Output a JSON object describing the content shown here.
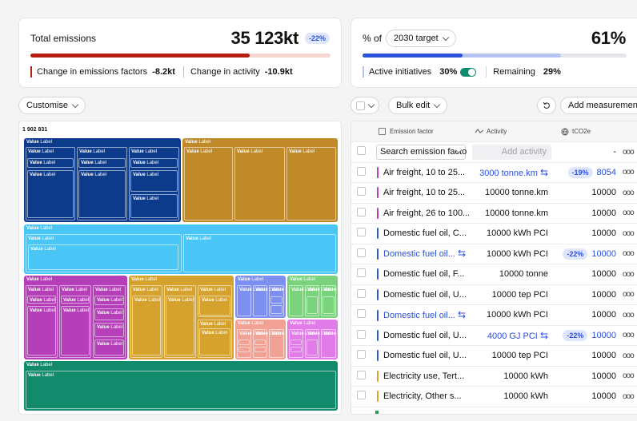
{
  "emissions_card": {
    "title": "Total emissions",
    "value": "35 123kt",
    "badge": "-22%",
    "progress": 0.73,
    "factors_label": "Change in emissions factors",
    "factors_value": "-8.2kt",
    "activity_label": "Change in activity",
    "activity_value": "-10.9kt"
  },
  "target_card": {
    "prefix": "% of",
    "target_select": "2030 target",
    "value": "61%",
    "progress_dark": 0.38,
    "progress_light": 0.75,
    "active_label": "Active initiatives",
    "active_value": "30%",
    "remaining_label": "Remaining",
    "remaining_value": "29%"
  },
  "left_panel": {
    "customise_label": "Customise",
    "treemap_total": "1 902 831",
    "value_word": "Value",
    "label_word": "Label"
  },
  "toolbar": {
    "bulk_edit_label": "Bulk edit",
    "add_measurement_label": "Add measurement"
  },
  "table": {
    "headers": {
      "factor": "Emission factor",
      "activity": "Activity",
      "tco2e": "tCO2e"
    },
    "search_placeholder": "Search emission facto",
    "add_activity_placeholder": "Add activity",
    "empty_value": "-",
    "rows": [
      {
        "factor": "Air freight, 10 to 25...",
        "color": "#b43fb8",
        "activity": "3000 tonne.km",
        "activity_blue": true,
        "swap": true,
        "badge": "-19%",
        "tco2e": "8054",
        "tco2e_blue": true
      },
      {
        "factor": "Air freight, 10 to 25...",
        "color": "#b43fb8",
        "activity": "10000 tonne.km",
        "tco2e": "10000"
      },
      {
        "factor": "Air freight, 26 to 100...",
        "color": "#b43fb8",
        "activity": "10000 tonne.km",
        "tco2e": "10000"
      },
      {
        "factor": "Domestic fuel oil, C...",
        "color": "#3356d6",
        "activity": "10000 kWh PCI",
        "tco2e": "10000"
      },
      {
        "factor": "Domestic fuel oil...",
        "color": "#3356d6",
        "factor_blue": true,
        "factor_swap": true,
        "activity": "10000 kWh PCI",
        "badge": "-22%",
        "tco2e": "10000",
        "tco2e_blue": true
      },
      {
        "factor": "Domestic fuel oil, F...",
        "color": "#3356d6",
        "activity": "10000 tonne",
        "tco2e": "10000"
      },
      {
        "factor": "Domestic fuel oil, U...",
        "color": "#3356d6",
        "activity": "10000 tep PCI",
        "tco2e": "10000"
      },
      {
        "factor": "Domestic fuel oil...",
        "color": "#3356d6",
        "factor_blue": true,
        "factor_swap": true,
        "activity": "10000 kWh PCI",
        "tco2e": "10000"
      },
      {
        "factor": "Domestic fuel oil, U...",
        "color": "#3356d6",
        "activity": "4000 GJ PCI",
        "activity_blue": true,
        "swap": true,
        "badge": "-22%",
        "tco2e": "10000",
        "tco2e_blue": true
      },
      {
        "factor": "Domestic fuel oil, U...",
        "color": "#3356d6",
        "activity": "10000 tep PCI",
        "tco2e": "10000"
      },
      {
        "factor": "Electricity use, Tert...",
        "color": "#d6a22e",
        "activity": "10000 kWh",
        "tco2e": "10000"
      },
      {
        "factor": "Electricity, Other s...",
        "color": "#d6a22e",
        "activity": "10000 kWh",
        "tco2e": "10000"
      }
    ]
  },
  "colors": {
    "navy": "#0d3b8c",
    "ochre": "#c08a28",
    "sky": "#49c6f5",
    "magenta": "#b43fb8",
    "gold": "#d6a22e",
    "periwinkle": "#7d8ff0",
    "mint": "#7ad27d",
    "salmon": "#f2a294",
    "orchid": "#e07be8",
    "teal": "#128b6c",
    "red_progress": "#b51f12",
    "blue_progress": "#2b50d9",
    "badge_bg": "#dfe6fc"
  }
}
